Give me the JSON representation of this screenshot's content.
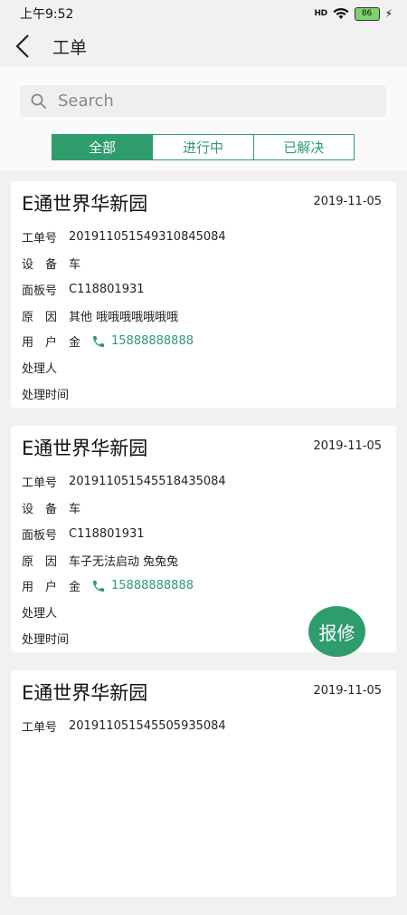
{
  "status_bar": {
    "time": "上午9:52",
    "signal": "HD",
    "battery": "86",
    "charging_icon": "bolt-icon"
  },
  "header": {
    "title": "工单",
    "back_icon": "chevron-left-icon"
  },
  "search": {
    "placeholder": "Search",
    "icon": "search-icon"
  },
  "tabs": [
    {
      "label": "全部",
      "active": true
    },
    {
      "label": "进行中",
      "active": false
    },
    {
      "label": "已解决",
      "active": false
    }
  ],
  "labels": {
    "order_no": "工单号",
    "device": "设　备",
    "panel_no": "面板号",
    "reason": "原　因",
    "user": "用　户",
    "handler": "处理人",
    "handle_time": "处理时间"
  },
  "orders": [
    {
      "title": "E通世界华新园",
      "date": "2019-11-05",
      "order_no": "201911051549310845084",
      "device": "车",
      "panel_no": "C118801931",
      "reason": "其他 哦哦哦哦哦哦哦",
      "user_name": "金",
      "phone": "15888888888",
      "handler": "",
      "handle_time": ""
    },
    {
      "title": "E通世界华新园",
      "date": "2019-11-05",
      "order_no": "201911051545518435084",
      "device": "车",
      "panel_no": "C118801931",
      "reason": "车子无法启动 兔兔兔",
      "user_name": "金",
      "phone": "15888888888",
      "handler": "",
      "handle_time": ""
    },
    {
      "title": "E通世界华新园",
      "date": "2019-11-05",
      "order_no": "201911051545505935084"
    }
  ],
  "fab": {
    "label": "报修"
  },
  "colors": {
    "accent": "#2f9c6e",
    "background": "#f1f1f1",
    "card": "#ffffff"
  }
}
